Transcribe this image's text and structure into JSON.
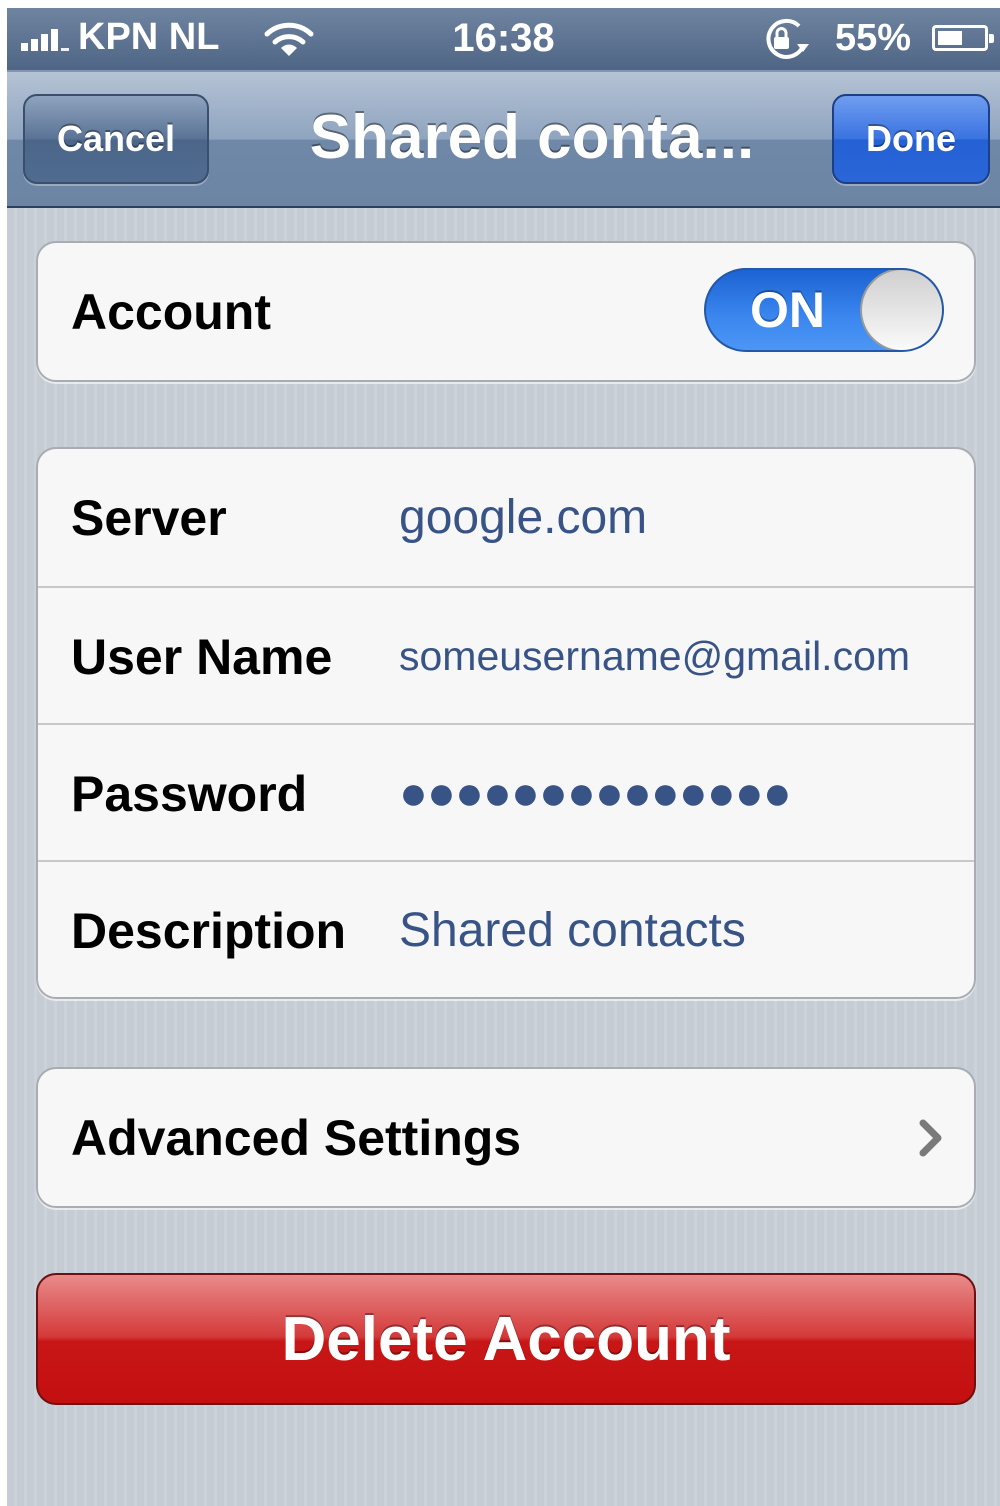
{
  "status_bar": {
    "carrier": "KPN NL",
    "time": "16:38",
    "battery": "55%",
    "battery_level": 0.55,
    "icons": [
      "signal-icon",
      "wifi-icon",
      "rotation-lock-icon",
      "battery-icon"
    ]
  },
  "nav": {
    "cancel_label": "Cancel",
    "title": "Shared conta...",
    "done_label": "Done"
  },
  "account": {
    "label": "Account",
    "toggle_label": "ON",
    "enabled": true
  },
  "fields": [
    {
      "label": "Server",
      "value": "google.com"
    },
    {
      "label": "User Name",
      "value": "someusername@gmail.com"
    },
    {
      "label": "Password",
      "value": "●●●●●●●●●●●●●●"
    },
    {
      "label": "Description",
      "value": "Shared contacts"
    }
  ],
  "advanced": {
    "label": "Advanced Settings",
    "icon": "chevron-right-icon"
  },
  "delete_label": "Delete Account",
  "colors": {
    "accent_blue": "#385487",
    "toggle_on": "#3b87ef",
    "delete_red": "#c81616"
  }
}
